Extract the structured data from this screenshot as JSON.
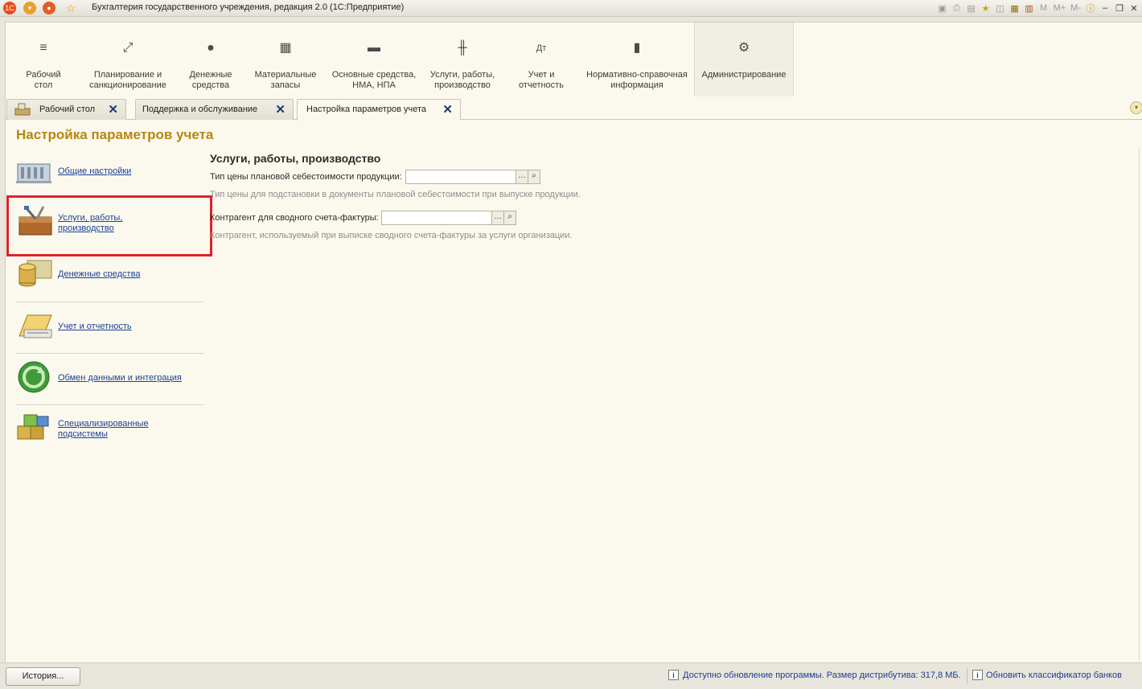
{
  "window": {
    "title": "Бухгалтерия государственного учреждения, редакция 2.0  (1С:Предприятие)",
    "toolbar_right": [
      "M",
      "M+",
      "M-"
    ]
  },
  "sections": [
    {
      "label": "Рабочий\nстол",
      "icon": "menu-icon"
    },
    {
      "label": "Планирование и\nсанкционирование",
      "icon": "planning-icon"
    },
    {
      "label": "Денежные\nсредства",
      "icon": "ruble-icon"
    },
    {
      "label": "Материальные\nзапасы",
      "icon": "grid-icon"
    },
    {
      "label": "Основные средства,\nНМА, НПА",
      "icon": "truck-icon"
    },
    {
      "label": "Услуги, работы,\nпроизводство",
      "icon": "tools-icon"
    },
    {
      "label": "Учет и\nотчетность",
      "icon": "debit-credit-icon"
    },
    {
      "label": "Нормативно-справочная\nинформация",
      "icon": "documents-icon"
    },
    {
      "label": "Администрирование",
      "icon": "gear-icon"
    }
  ],
  "tabs": [
    {
      "label": "Рабочий стол"
    },
    {
      "label": "Поддержка и обслуживание"
    },
    {
      "label": "Настройка параметров учета"
    }
  ],
  "page": {
    "title": "Настройка параметров учета"
  },
  "nav": [
    {
      "label": "Общие настройки"
    },
    {
      "label": "Услуги, работы,\nпроизводство"
    },
    {
      "label": "Денежные средства"
    },
    {
      "label": "Учет и отчетность"
    },
    {
      "label": "Обмен данными и интеграция"
    },
    {
      "label": "Специализированные\nподсистемы"
    }
  ],
  "content": {
    "title": "Услуги, работы, производство",
    "fields": [
      {
        "label": "Тип цены плановой себестоимости продукции:",
        "value": "",
        "hint": "Тип цены для подстановки в документы плановой себестоимости при выпуске продукции."
      },
      {
        "label": "Контрагент для сводного счета-фактуры:",
        "value": "",
        "hint": "Контрагент, используемый при выписке сводного счета-фактуры за услуги организации."
      }
    ]
  },
  "statusbar": {
    "history": "История...",
    "update_msg": "Доступно обновление программы. Размер дистрибутива: 317,8 МБ.",
    "bank_msg": "Обновить классификатор банков"
  },
  "colors": {
    "accent": "#b5870f",
    "link": "#1c3f94",
    "highlight": "#e0202a"
  }
}
